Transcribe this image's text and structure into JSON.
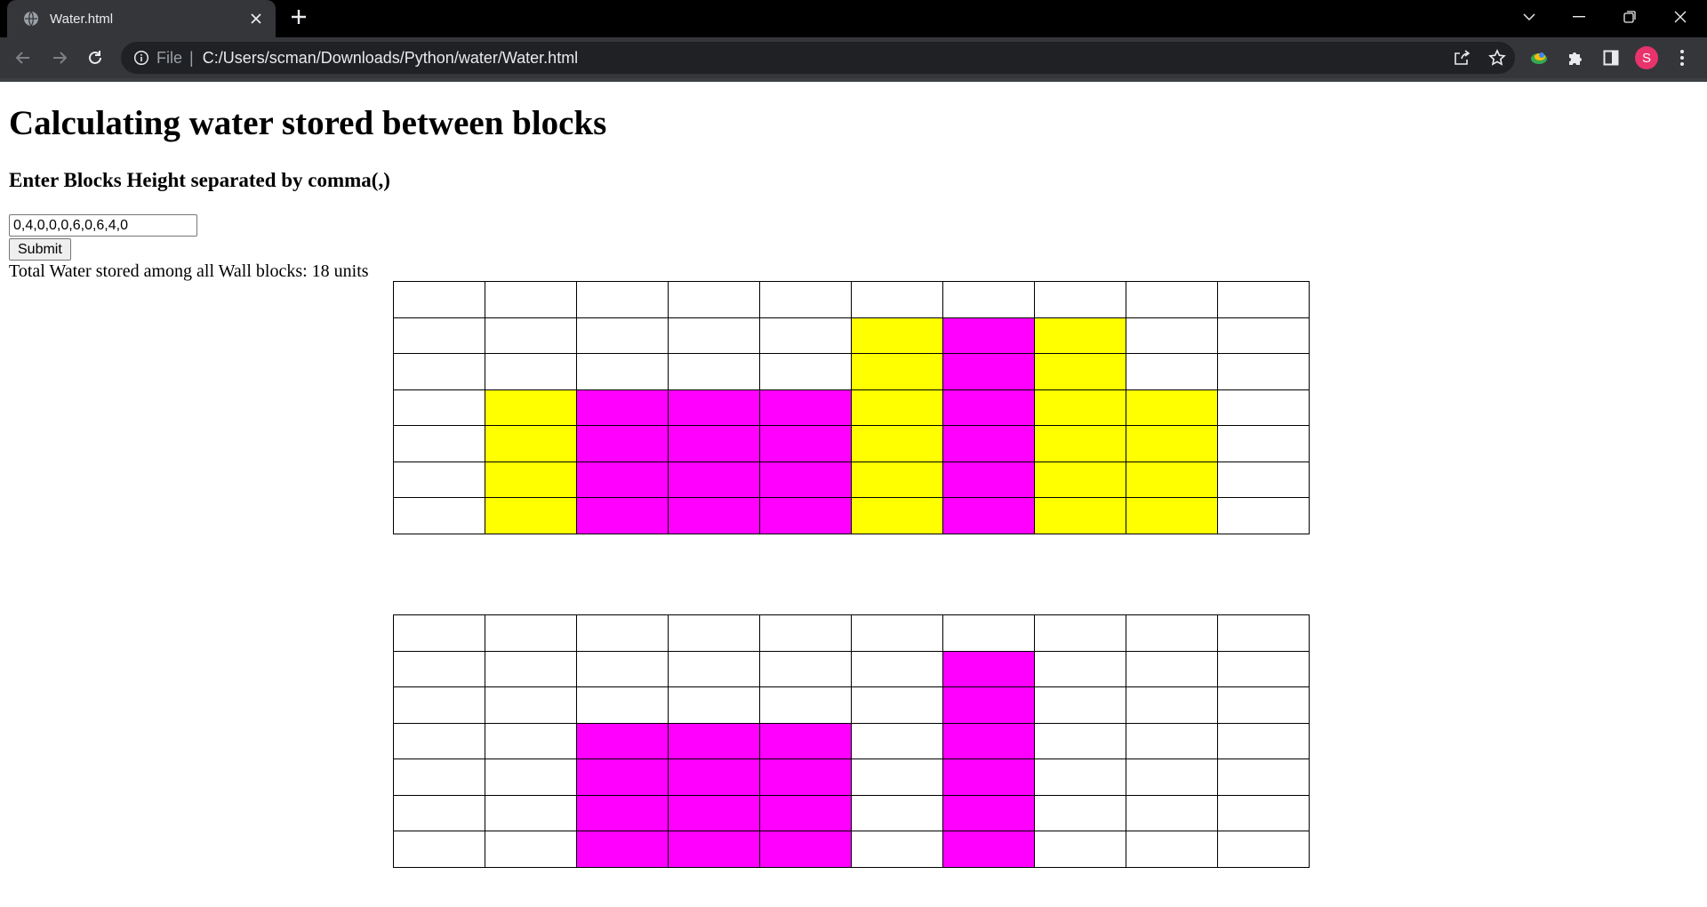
{
  "browser": {
    "tab_title": "Water.html",
    "scheme": "File",
    "url": "C:/Users/scman/Downloads/Python/water/Water.html",
    "profile_initial": "S",
    "colors": {
      "chrome_dark": "#35363a",
      "tabbar": "#000000",
      "omnibox": "#202124",
      "avatar": "#e8336d"
    }
  },
  "page": {
    "heading": "Calculating water stored between blocks",
    "prompt": "Enter Blocks Height separated by comma(,)",
    "input_value": "0,4,0,0,0,6,0,6,4,0",
    "submit_label": "Submit",
    "result": "Total Water stored among all Wall blocks: 18 units"
  },
  "grids": {
    "rows": 7,
    "cols": 10,
    "colors": {
      "wall": "#ffff00",
      "water": "#ff00ff",
      "empty": "#ffffff"
    },
    "grid1_cells": [
      [
        "",
        "",
        "",
        "",
        "",
        "",
        "",
        "",
        "",
        ""
      ],
      [
        "",
        "",
        "",
        "",
        "",
        "wall",
        "water",
        "wall",
        "",
        ""
      ],
      [
        "",
        "",
        "",
        "",
        "",
        "wall",
        "water",
        "wall",
        "",
        ""
      ],
      [
        "",
        "wall",
        "water",
        "water",
        "water",
        "wall",
        "water",
        "wall",
        "wall",
        ""
      ],
      [
        "",
        "wall",
        "water",
        "water",
        "water",
        "wall",
        "water",
        "wall",
        "wall",
        ""
      ],
      [
        "",
        "wall",
        "water",
        "water",
        "water",
        "wall",
        "water",
        "wall",
        "wall",
        ""
      ],
      [
        "",
        "wall",
        "water",
        "water",
        "water",
        "wall",
        "water",
        "wall",
        "wall",
        ""
      ]
    ],
    "grid2_cells": [
      [
        "",
        "",
        "",
        "",
        "",
        "",
        "",
        "",
        "",
        ""
      ],
      [
        "",
        "",
        "",
        "",
        "",
        "",
        "water",
        "",
        "",
        ""
      ],
      [
        "",
        "",
        "",
        "",
        "",
        "",
        "water",
        "",
        "",
        ""
      ],
      [
        "",
        "",
        "water",
        "water",
        "water",
        "",
        "water",
        "",
        "",
        ""
      ],
      [
        "",
        "",
        "water",
        "water",
        "water",
        "",
        "water",
        "",
        "",
        ""
      ],
      [
        "",
        "",
        "water",
        "water",
        "water",
        "",
        "water",
        "",
        "",
        ""
      ],
      [
        "",
        "",
        "water",
        "water",
        "water",
        "",
        "water",
        "",
        "",
        ""
      ]
    ]
  },
  "icons": {
    "tab_favicon": "globe-icon",
    "tab_close": "close-icon",
    "new_tab": "plus-icon",
    "back": "arrow-left-icon",
    "forward": "arrow-right-icon",
    "reload": "reload-icon",
    "site_info": "info-icon",
    "share": "share-icon",
    "bookmark": "star-icon",
    "extension_colorful": "extension-color-icon",
    "extensions": "puzzle-icon",
    "side_panel": "side-panel-icon",
    "menu": "kebab-menu-icon"
  }
}
